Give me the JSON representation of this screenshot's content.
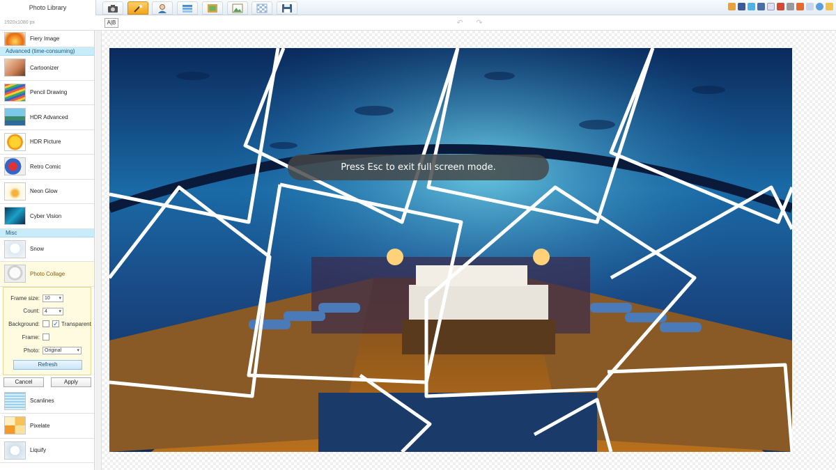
{
  "app": {
    "library_title": "Photo Library"
  },
  "toolbar": {
    "tools": [
      {
        "name": "camera-icon",
        "active": false
      },
      {
        "name": "magic-wand-icon",
        "active": true
      },
      {
        "name": "person-icon",
        "active": false
      },
      {
        "name": "layers-icon",
        "active": false
      },
      {
        "name": "frame-icon",
        "active": false
      },
      {
        "name": "picture-icon",
        "active": false
      },
      {
        "name": "transparency-icon",
        "active": false
      },
      {
        "name": "save-icon",
        "active": false
      }
    ],
    "share_icons": [
      "home-icon",
      "facebook-icon",
      "twitter-icon",
      "digg-icon",
      "stumble-icon",
      "google-plus-icon",
      "myspace-icon",
      "delicious-icon",
      "reddit-icon",
      "help-icon",
      "email-icon"
    ]
  },
  "subbar": {
    "image_size": "1920x1080 px",
    "ab_label": "A|B"
  },
  "sidebar": {
    "top_item": {
      "label": "Fiery Image"
    },
    "section_advanced": "Advanced (time-consuming)",
    "advanced_items": [
      {
        "label": "Cartoonizer"
      },
      {
        "label": "Pencil Drawing"
      },
      {
        "label": "HDR Advanced"
      },
      {
        "label": "HDR Picture"
      },
      {
        "label": "Retro Comic"
      },
      {
        "label": "Neon Glow"
      },
      {
        "label": "Cyber Vision"
      }
    ],
    "section_misc": "Misc",
    "misc_items": [
      {
        "label": "Snow"
      },
      {
        "label": "Photo Collage"
      }
    ],
    "options": {
      "frame_size_label": "Frame size:",
      "frame_size_value": "10",
      "count_label": "Count:",
      "count_value": "4",
      "background_label": "Background:",
      "transparent_label": "Transparent",
      "transparent_checked": true,
      "frame_label": "Frame:",
      "photo_label": "Photo:",
      "photo_value": "Original",
      "refresh_label": "Refresh",
      "cancel_label": "Cancel",
      "apply_label": "Apply"
    },
    "bottom_items": [
      {
        "label": "Scanlines"
      },
      {
        "label": "Pixelate"
      },
      {
        "label": "Liquify"
      }
    ]
  },
  "canvas": {
    "toast": "Press Esc to exit full screen mode."
  },
  "colors": {
    "accent": "#f2a319",
    "section_bg": "#c9ecfa",
    "selected_bg": "#fffbe0"
  }
}
